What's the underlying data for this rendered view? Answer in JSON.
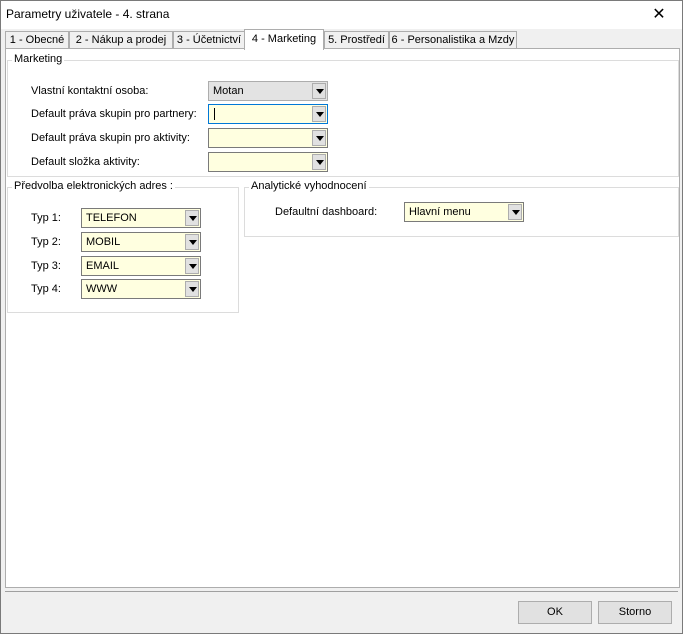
{
  "window": {
    "title": "Parametry uživatele - 4. strana",
    "close_glyph": "✕"
  },
  "tabs": [
    {
      "label": "1 - Obecné"
    },
    {
      "label": "2 - Nákup a prodej"
    },
    {
      "label": "3 - Účetnictví"
    },
    {
      "label": "4 - Marketing"
    },
    {
      "label": "5. Prostředí"
    },
    {
      "label": "6 - Personalistika a Mzdy"
    }
  ],
  "marketing": {
    "group_label": "Marketing",
    "fields": [
      {
        "label": "Vlastní kontaktní osoba:",
        "value": "Motan"
      },
      {
        "label": "Default práva skupin pro partnery:",
        "value": ""
      },
      {
        "label": "Default práva skupin pro aktivity:",
        "value": ""
      },
      {
        "label": "Default složka aktivity:",
        "value": ""
      }
    ]
  },
  "predvolba": {
    "group_label": "Předvolba elektronických adres :",
    "fields": [
      {
        "label": "Typ 1:",
        "value": "TELEFON"
      },
      {
        "label": "Typ 2:",
        "value": "MOBIL"
      },
      {
        "label": "Typ 3:",
        "value": "EMAIL"
      },
      {
        "label": "Typ 4:",
        "value": "WWW"
      }
    ]
  },
  "analyticke": {
    "group_label": "Analytické vyhodnocení",
    "dashboard_label": "Defaultní dashboard:",
    "dashboard_value": "Hlavní menu"
  },
  "buttons": {
    "ok": "OK",
    "cancel": "Storno"
  }
}
